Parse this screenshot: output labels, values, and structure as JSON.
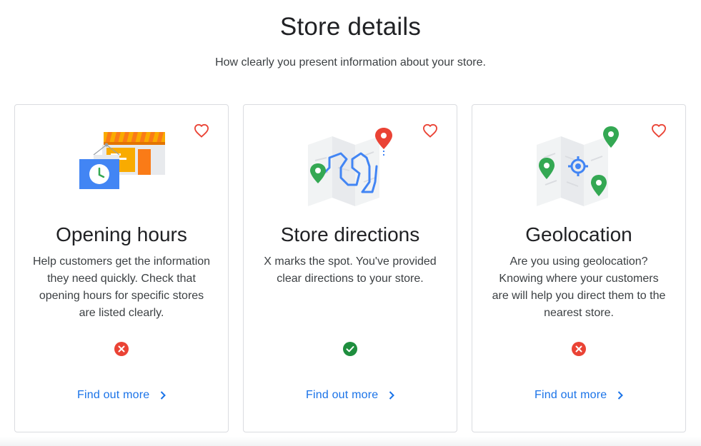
{
  "header": {
    "title": "Store details",
    "subtitle": "How clearly you present information about your store."
  },
  "cards": [
    {
      "title": "Opening hours",
      "description": "Help customers get the information they need quickly. Check that opening hours for specific stores are listed clearly.",
      "status": "fail",
      "link_label": "Find out more"
    },
    {
      "title": "Store directions",
      "description": "X marks the spot. You've provided clear directions to your store.",
      "status": "pass",
      "link_label": "Find out more"
    },
    {
      "title": "Geolocation",
      "description": "Are you using geolocation? Knowing where your customers are will help you direct them to the nearest store.",
      "status": "fail",
      "link_label": "Find out more"
    }
  ],
  "colors": {
    "link": "#1a73e8",
    "fail": "#ea4335",
    "pass": "#1e8e3e",
    "heart": "#ea4335"
  },
  "icons": {
    "favorite": "heart-outline-icon",
    "fail": "close-circle-icon",
    "pass": "check-circle-icon",
    "link": "chevron-right-icon"
  }
}
